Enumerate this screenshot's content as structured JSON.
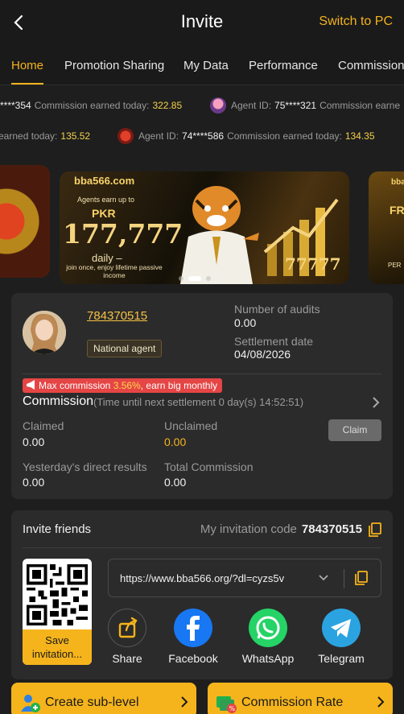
{
  "header": {
    "title": "Invite",
    "switch_label": "Switch to PC"
  },
  "tabs": [
    {
      "label": "Home",
      "active": true
    },
    {
      "label": "Promotion Sharing"
    },
    {
      "label": "My Data"
    },
    {
      "label": "Performance"
    },
    {
      "label": "Commission"
    }
  ],
  "ticker": {
    "row1": [
      {
        "agent_id": "****354",
        "label": "Commission earned today:",
        "amount": "322.85"
      },
      {
        "agent_label": "Agent ID:",
        "agent_id": "75****321",
        "label": "Commission earne"
      }
    ],
    "row2": [
      {
        "label": "earned today:",
        "amount": "135.52"
      },
      {
        "agent_label": "Agent ID:",
        "agent_id": "74****586",
        "label": "Commission earned today:",
        "amount": "134.35"
      }
    ]
  },
  "banner": {
    "logo": "bba566.com",
    "line1": "Agents earn up to",
    "currency": "PKR",
    "amount": "177,777",
    "period": "daily –",
    "sub": "join once, enjoy lifetime passive income",
    "bg_number": "77777",
    "right_text": "FR",
    "right_text2": "PER",
    "active_slide": 2,
    "slides": 3
  },
  "profile": {
    "agent_id": "784370515",
    "level": "National agent",
    "audits_label": "Number of audits",
    "audits_value": "0.00",
    "settlement_label": "Settlement date",
    "settlement_value": "04/08/2026"
  },
  "commission": {
    "promo_prefix": "Max commission",
    "promo_pct": "3.56%",
    "promo_suffix": ", earn big monthly",
    "title": "Commission",
    "countdown": "(Time until next settlement  0 day(s) 14:52:51)",
    "claimed_label": "Claimed",
    "claimed_value": "0.00",
    "unclaimed_label": "Unclaimed",
    "unclaimed_value": "0.00",
    "claim_button": "Claim",
    "yesterday_label": "Yesterday's direct results",
    "yesterday_value": "0.00",
    "total_label": "Total Commission",
    "total_value": "0.00"
  },
  "invite": {
    "title": "Invite friends",
    "code_label": "My invitation code",
    "code_value": "784370515",
    "save_label": "Save invitation...",
    "link": "https://www.bba566.org/?dl=cyzs5v",
    "share": [
      {
        "label": "Share",
        "icon": "share-icon",
        "color": "#2b2b2b"
      },
      {
        "label": "Facebook",
        "icon": "facebook-icon",
        "color": "#1877f2"
      },
      {
        "label": "WhatsApp",
        "icon": "whatsapp-icon",
        "color": "#25d366"
      },
      {
        "label": "Telegram",
        "icon": "telegram-icon",
        "color": "#2aa3e0"
      }
    ]
  },
  "bottom": {
    "create_label": "Create sub-level",
    "rate_label": "Commission Rate"
  },
  "colors": {
    "accent": "#f5b41c",
    "card": "#2b2b2b",
    "bg": "#1e1e1e",
    "promo": "#e54545"
  }
}
